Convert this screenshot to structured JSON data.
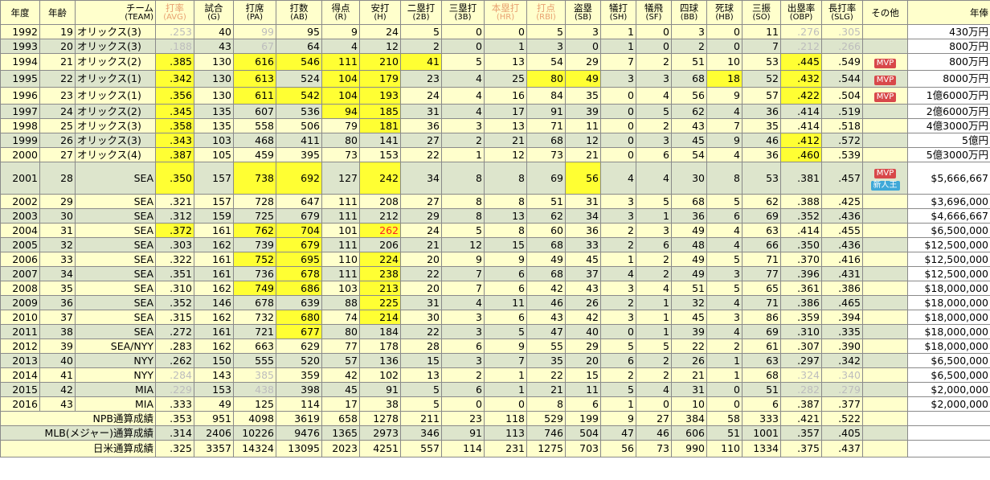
{
  "headers": [
    {
      "jp": "年度",
      "en": ""
    },
    {
      "jp": "年齢",
      "en": ""
    },
    {
      "jp": "チーム",
      "en": "(TEAM)"
    },
    {
      "jp": "打率",
      "en": "(AVG)"
    },
    {
      "jp": "試合",
      "en": "(G)"
    },
    {
      "jp": "打席",
      "en": "(PA)"
    },
    {
      "jp": "打数",
      "en": "(AB)"
    },
    {
      "jp": "得点",
      "en": "(R)"
    },
    {
      "jp": "安打",
      "en": "(H)"
    },
    {
      "jp": "二塁打",
      "en": "(2B)"
    },
    {
      "jp": "三塁打",
      "en": "(3B)"
    },
    {
      "jp": "本塁打",
      "en": "(HR)"
    },
    {
      "jp": "打点",
      "en": "(RBI)"
    },
    {
      "jp": "盗塁",
      "en": "(SB)"
    },
    {
      "jp": "犠打",
      "en": "(SH)"
    },
    {
      "jp": "犠飛",
      "en": "(SF)"
    },
    {
      "jp": "四球",
      "en": "(BB)"
    },
    {
      "jp": "死球",
      "en": "(HB)"
    },
    {
      "jp": "三振",
      "en": "(SO)"
    },
    {
      "jp": "出塁率",
      "en": "(OBP)"
    },
    {
      "jp": "長打率",
      "en": "(SLG)"
    },
    {
      "jp": "その他",
      "en": ""
    },
    {
      "jp": "年俸",
      "en": ""
    }
  ],
  "rows": [
    {
      "year": "1992",
      "age": "19",
      "team": "オリックス(3)",
      "avg": ".253",
      "g": "40",
      "pa": "99",
      "ab": "95",
      "r": "9",
      "h": "24",
      "b2": "5",
      "b3": "0",
      "hr": "0",
      "rbi": "5",
      "sb": "3",
      "sh": "1",
      "sf": "0",
      "bb": "3",
      "hb": "0",
      "so": "11",
      "obp": ".276",
      "slg": ".305",
      "badges": [],
      "salary": "430万円",
      "grey": [
        "avg",
        "pa",
        "obp",
        "slg"
      ],
      "hl": []
    },
    {
      "year": "1993",
      "age": "20",
      "team": "オリックス(3)",
      "avg": ".188",
      "g": "43",
      "pa": "67",
      "ab": "64",
      "r": "4",
      "h": "12",
      "b2": "2",
      "b3": "0",
      "hr": "1",
      "rbi": "3",
      "sb": "0",
      "sh": "1",
      "sf": "0",
      "bb": "2",
      "hb": "0",
      "so": "7",
      "obp": ".212",
      "slg": ".266",
      "badges": [],
      "salary": "800万円",
      "grey": [
        "avg",
        "pa",
        "obp",
        "slg"
      ],
      "hl": []
    },
    {
      "year": "1994",
      "age": "21",
      "team": "オリックス(2)",
      "avg": ".385",
      "g": "130",
      "pa": "616",
      "ab": "546",
      "r": "111",
      "h": "210",
      "b2": "41",
      "b3": "5",
      "hr": "13",
      "rbi": "54",
      "sb": "29",
      "sh": "7",
      "sf": "2",
      "bb": "51",
      "hb": "10",
      "so": "53",
      "obp": ".445",
      "slg": ".549",
      "badges": [
        "MVP"
      ],
      "salary": "800万円",
      "grey": [],
      "hl": [
        "avg",
        "pa",
        "ab",
        "r",
        "h",
        "b2",
        "obp"
      ]
    },
    {
      "year": "1995",
      "age": "22",
      "team": "オリックス(1)",
      "avg": ".342",
      "g": "130",
      "pa": "613",
      "ab": "524",
      "r": "104",
      "h": "179",
      "b2": "23",
      "b3": "4",
      "hr": "25",
      "rbi": "80",
      "sb": "49",
      "sh": "3",
      "sf": "3",
      "bb": "68",
      "hb": "18",
      "so": "52",
      "obp": ".432",
      "slg": ".544",
      "badges": [
        "MVP"
      ],
      "salary": "8000万円",
      "grey": [],
      "hl": [
        "avg",
        "pa",
        "r",
        "h",
        "rbi",
        "sb",
        "hb",
        "obp"
      ]
    },
    {
      "year": "1996",
      "age": "23",
      "team": "オリックス(1)",
      "avg": ".356",
      "g": "130",
      "pa": "611",
      "ab": "542",
      "r": "104",
      "h": "193",
      "b2": "24",
      "b3": "4",
      "hr": "16",
      "rbi": "84",
      "sb": "35",
      "sh": "0",
      "sf": "4",
      "bb": "56",
      "hb": "9",
      "so": "57",
      "obp": ".422",
      "slg": ".504",
      "badges": [
        "MVP"
      ],
      "salary": "1億6000万円",
      "grey": [],
      "hl": [
        "avg",
        "pa",
        "ab",
        "r",
        "h",
        "obp"
      ]
    },
    {
      "year": "1997",
      "age": "24",
      "team": "オリックス(2)",
      "avg": ".345",
      "g": "135",
      "pa": "607",
      "ab": "536",
      "r": "94",
      "h": "185",
      "b2": "31",
      "b3": "4",
      "hr": "17",
      "rbi": "91",
      "sb": "39",
      "sh": "0",
      "sf": "5",
      "bb": "62",
      "hb": "4",
      "so": "36",
      "obp": ".414",
      "slg": ".519",
      "badges": [],
      "salary": "2億6000万円",
      "grey": [],
      "hl": [
        "avg",
        "r",
        "h"
      ]
    },
    {
      "year": "1998",
      "age": "25",
      "team": "オリックス(3)",
      "avg": ".358",
      "g": "135",
      "pa": "558",
      "ab": "506",
      "r": "79",
      "h": "181",
      "b2": "36",
      "b3": "3",
      "hr": "13",
      "rbi": "71",
      "sb": "11",
      "sh": "0",
      "sf": "2",
      "bb": "43",
      "hb": "7",
      "so": "35",
      "obp": ".414",
      "slg": ".518",
      "badges": [],
      "salary": "4億3000万円",
      "grey": [],
      "hl": [
        "avg",
        "h"
      ]
    },
    {
      "year": "1999",
      "age": "26",
      "team": "オリックス(3)",
      "avg": ".343",
      "g": "103",
      "pa": "468",
      "ab": "411",
      "r": "80",
      "h": "141",
      "b2": "27",
      "b3": "2",
      "hr": "21",
      "rbi": "68",
      "sb": "12",
      "sh": "0",
      "sf": "3",
      "bb": "45",
      "hb": "9",
      "so": "46",
      "obp": ".412",
      "slg": ".572",
      "badges": [],
      "salary": "5億円",
      "grey": [],
      "hl": [
        "avg",
        "obp"
      ]
    },
    {
      "year": "2000",
      "age": "27",
      "team": "オリックス(4)",
      "avg": ".387",
      "g": "105",
      "pa": "459",
      "ab": "395",
      "r": "73",
      "h": "153",
      "b2": "22",
      "b3": "1",
      "hr": "12",
      "rbi": "73",
      "sb": "21",
      "sh": "0",
      "sf": "6",
      "bb": "54",
      "hb": "4",
      "so": "36",
      "obp": ".460",
      "slg": ".539",
      "badges": [],
      "salary": "5億3000万円",
      "grey": [],
      "hl": [
        "avg",
        "obp"
      ]
    },
    {
      "year": "2001",
      "age": "28",
      "team": "SEA",
      "avg": ".350",
      "g": "157",
      "pa": "738",
      "ab": "692",
      "r": "127",
      "h": "242",
      "b2": "34",
      "b3": "8",
      "hr": "8",
      "rbi": "69",
      "sb": "56",
      "sh": "4",
      "sf": "4",
      "bb": "30",
      "hb": "8",
      "so": "53",
      "obp": ".381",
      "slg": ".457",
      "badges": [
        "MVP",
        "新人王"
      ],
      "salary": "$5,666,667",
      "grey": [],
      "hl": [
        "avg",
        "pa",
        "ab",
        "h",
        "sb"
      ]
    },
    {
      "year": "2002",
      "age": "29",
      "team": "SEA",
      "avg": ".321",
      "g": "157",
      "pa": "728",
      "ab": "647",
      "r": "111",
      "h": "208",
      "b2": "27",
      "b3": "8",
      "hr": "8",
      "rbi": "51",
      "sb": "31",
      "sh": "3",
      "sf": "5",
      "bb": "68",
      "hb": "5",
      "so": "62",
      "obp": ".388",
      "slg": ".425",
      "badges": [],
      "salary": "$3,696,000",
      "grey": [],
      "hl": []
    },
    {
      "year": "2003",
      "age": "30",
      "team": "SEA",
      "avg": ".312",
      "g": "159",
      "pa": "725",
      "ab": "679",
      "r": "111",
      "h": "212",
      "b2": "29",
      "b3": "8",
      "hr": "13",
      "rbi": "62",
      "sb": "34",
      "sh": "3",
      "sf": "1",
      "bb": "36",
      "hb": "6",
      "so": "69",
      "obp": ".352",
      "slg": ".436",
      "badges": [],
      "salary": "$4,666,667",
      "grey": [],
      "hl": []
    },
    {
      "year": "2004",
      "age": "31",
      "team": "SEA",
      "avg": ".372",
      "g": "161",
      "pa": "762",
      "ab": "704",
      "r": "101",
      "h": "262",
      "b2": "24",
      "b3": "5",
      "hr": "8",
      "rbi": "60",
      "sb": "36",
      "sh": "2",
      "sf": "3",
      "bb": "49",
      "hb": "4",
      "so": "63",
      "obp": ".414",
      "slg": ".455",
      "badges": [],
      "salary": "$6,500,000",
      "grey": [],
      "hl": [
        "avg",
        "pa",
        "ab",
        "h"
      ],
      "red": [
        "h"
      ]
    },
    {
      "year": "2005",
      "age": "32",
      "team": "SEA",
      "avg": ".303",
      "g": "162",
      "pa": "739",
      "ab": "679",
      "r": "111",
      "h": "206",
      "b2": "21",
      "b3": "12",
      "hr": "15",
      "rbi": "68",
      "sb": "33",
      "sh": "2",
      "sf": "6",
      "bb": "48",
      "hb": "4",
      "so": "66",
      "obp": ".350",
      "slg": ".436",
      "badges": [],
      "salary": "$12,500,000",
      "grey": [],
      "hl": [
        "ab"
      ]
    },
    {
      "year": "2006",
      "age": "33",
      "team": "SEA",
      "avg": ".322",
      "g": "161",
      "pa": "752",
      "ab": "695",
      "r": "110",
      "h": "224",
      "b2": "20",
      "b3": "9",
      "hr": "9",
      "rbi": "49",
      "sb": "45",
      "sh": "1",
      "sf": "2",
      "bb": "49",
      "hb": "5",
      "so": "71",
      "obp": ".370",
      "slg": ".416",
      "badges": [],
      "salary": "$12,500,000",
      "grey": [],
      "hl": [
        "pa",
        "ab",
        "h"
      ]
    },
    {
      "year": "2007",
      "age": "34",
      "team": "SEA",
      "avg": ".351",
      "g": "161",
      "pa": "736",
      "ab": "678",
      "r": "111",
      "h": "238",
      "b2": "22",
      "b3": "7",
      "hr": "6",
      "rbi": "68",
      "sb": "37",
      "sh": "4",
      "sf": "2",
      "bb": "49",
      "hb": "3",
      "so": "77",
      "obp": ".396",
      "slg": ".431",
      "badges": [],
      "salary": "$12,500,000",
      "grey": [],
      "hl": [
        "ab",
        "h"
      ]
    },
    {
      "year": "2008",
      "age": "35",
      "team": "SEA",
      "avg": ".310",
      "g": "162",
      "pa": "749",
      "ab": "686",
      "r": "103",
      "h": "213",
      "b2": "20",
      "b3": "7",
      "hr": "6",
      "rbi": "42",
      "sb": "43",
      "sh": "3",
      "sf": "4",
      "bb": "51",
      "hb": "5",
      "so": "65",
      "obp": ".361",
      "slg": ".386",
      "badges": [],
      "salary": "$18,000,000",
      "grey": [],
      "hl": [
        "pa",
        "ab",
        "h"
      ]
    },
    {
      "year": "2009",
      "age": "36",
      "team": "SEA",
      "avg": ".352",
      "g": "146",
      "pa": "678",
      "ab": "639",
      "r": "88",
      "h": "225",
      "b2": "31",
      "b3": "4",
      "hr": "11",
      "rbi": "46",
      "sb": "26",
      "sh": "2",
      "sf": "1",
      "bb": "32",
      "hb": "4",
      "so": "71",
      "obp": ".386",
      "slg": ".465",
      "badges": [],
      "salary": "$18,000,000",
      "grey": [],
      "hl": [
        "h"
      ]
    },
    {
      "year": "2010",
      "age": "37",
      "team": "SEA",
      "avg": ".315",
      "g": "162",
      "pa": "732",
      "ab": "680",
      "r": "74",
      "h": "214",
      "b2": "30",
      "b3": "3",
      "hr": "6",
      "rbi": "43",
      "sb": "42",
      "sh": "3",
      "sf": "1",
      "bb": "45",
      "hb": "3",
      "so": "86",
      "obp": ".359",
      "slg": ".394",
      "badges": [],
      "salary": "$18,000,000",
      "grey": [],
      "hl": [
        "ab",
        "h"
      ]
    },
    {
      "year": "2011",
      "age": "38",
      "team": "SEA",
      "avg": ".272",
      "g": "161",
      "pa": "721",
      "ab": "677",
      "r": "80",
      "h": "184",
      "b2": "22",
      "b3": "3",
      "hr": "5",
      "rbi": "47",
      "sb": "40",
      "sh": "0",
      "sf": "1",
      "bb": "39",
      "hb": "4",
      "so": "69",
      "obp": ".310",
      "slg": ".335",
      "badges": [],
      "salary": "$18,000,000",
      "grey": [],
      "hl": [
        "ab"
      ]
    },
    {
      "year": "2012",
      "age": "39",
      "team": "SEA/NYY",
      "avg": ".283",
      "g": "162",
      "pa": "663",
      "ab": "629",
      "r": "77",
      "h": "178",
      "b2": "28",
      "b3": "6",
      "hr": "9",
      "rbi": "55",
      "sb": "29",
      "sh": "5",
      "sf": "5",
      "bb": "22",
      "hb": "2",
      "so": "61",
      "obp": ".307",
      "slg": ".390",
      "badges": [],
      "salary": "$18,000,000",
      "grey": [],
      "hl": []
    },
    {
      "year": "2013",
      "age": "40",
      "team": "NYY",
      "avg": ".262",
      "g": "150",
      "pa": "555",
      "ab": "520",
      "r": "57",
      "h": "136",
      "b2": "15",
      "b3": "3",
      "hr": "7",
      "rbi": "35",
      "sb": "20",
      "sh": "6",
      "sf": "2",
      "bb": "26",
      "hb": "1",
      "so": "63",
      "obp": ".297",
      "slg": ".342",
      "badges": [],
      "salary": "$6,500,000",
      "grey": [],
      "hl": []
    },
    {
      "year": "2014",
      "age": "41",
      "team": "NYY",
      "avg": ".284",
      "g": "143",
      "pa": "385",
      "ab": "359",
      "r": "42",
      "h": "102",
      "b2": "13",
      "b3": "2",
      "hr": "1",
      "rbi": "22",
      "sb": "15",
      "sh": "2",
      "sf": "2",
      "bb": "21",
      "hb": "1",
      "so": "68",
      "obp": ".324",
      "slg": ".340",
      "badges": [],
      "salary": "$6,500,000",
      "grey": [
        "avg",
        "pa",
        "obp",
        "slg"
      ],
      "hl": []
    },
    {
      "year": "2015",
      "age": "42",
      "team": "MIA",
      "avg": ".229",
      "g": "153",
      "pa": "438",
      "ab": "398",
      "r": "45",
      "h": "91",
      "b2": "5",
      "b3": "6",
      "hr": "1",
      "rbi": "21",
      "sb": "11",
      "sh": "5",
      "sf": "4",
      "bb": "31",
      "hb": "0",
      "so": "51",
      "obp": ".282",
      "slg": ".279",
      "badges": [],
      "salary": "$2,000,000",
      "grey": [
        "avg",
        "pa",
        "obp",
        "slg"
      ],
      "hl": []
    },
    {
      "year": "2016",
      "age": "43",
      "team": "MIA",
      "avg": ".333",
      "g": "49",
      "pa": "125",
      "ab": "114",
      "r": "17",
      "h": "38",
      "b2": "5",
      "b3": "0",
      "hr": "0",
      "rbi": "8",
      "sb": "6",
      "sh": "1",
      "sf": "0",
      "bb": "10",
      "hb": "0",
      "so": "6",
      "obp": ".387",
      "slg": ".377",
      "badges": [],
      "salary": "$2,000,000",
      "grey": [],
      "hl": []
    }
  ],
  "totals": [
    {
      "label": "NPB通算成績",
      "avg": ".353",
      "g": "951",
      "pa": "4098",
      "ab": "3619",
      "r": "658",
      "h": "1278",
      "b2": "211",
      "b3": "23",
      "hr": "118",
      "rbi": "529",
      "sb": "199",
      "sh": "9",
      "sf": "27",
      "bb": "384",
      "hb": "58",
      "so": "333",
      "obp": ".421",
      "slg": ".522"
    },
    {
      "label": "MLB(メジャー)通算成績",
      "avg": ".314",
      "g": "2406",
      "pa": "10226",
      "ab": "9476",
      "r": "1365",
      "h": "2973",
      "b2": "346",
      "b3": "91",
      "hr": "113",
      "rbi": "746",
      "sb": "504",
      "sh": "47",
      "sf": "46",
      "bb": "606",
      "hb": "51",
      "so": "1001",
      "obp": ".357",
      "slg": ".405"
    },
    {
      "label": "日米通算成績",
      "avg": ".325",
      "g": "3357",
      "pa": "14324",
      "ab": "13095",
      "r": "2023",
      "h": "4251",
      "b2": "557",
      "b3": "114",
      "hr": "231",
      "rbi": "1275",
      "sb": "703",
      "sh": "56",
      "sf": "73",
      "bb": "990",
      "hb": "110",
      "so": "1334",
      "obp": ".375",
      "slg": ".437"
    }
  ],
  "colors": {
    "highlight": "#ffff33",
    "row_light": "#ffffcc",
    "row_green": "#dde5cc",
    "header_orange": "#e8a070",
    "mvp_badge": "#d8484a",
    "rookie_badge": "#3fa8d8",
    "record_red": "#ff2020"
  }
}
